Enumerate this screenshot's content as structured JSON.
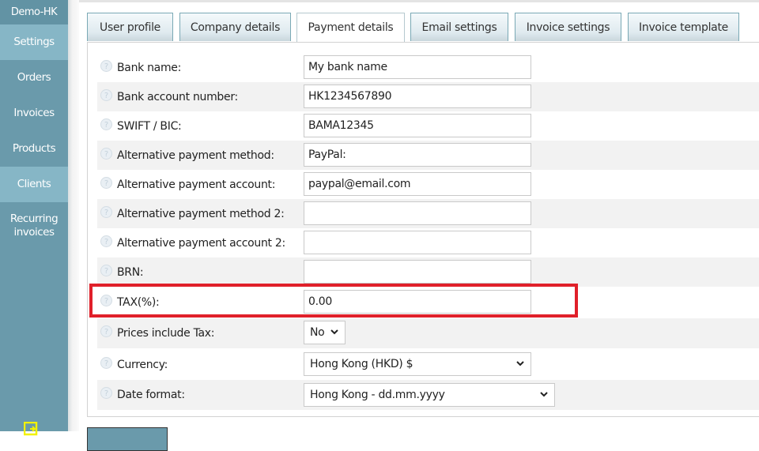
{
  "sidebar": {
    "brand": "Demo-HK",
    "items": [
      {
        "label": "Settings",
        "active": true
      },
      {
        "label": "Orders",
        "active": false
      },
      {
        "label": "Invoices",
        "active": false
      },
      {
        "label": "Products",
        "active": false
      },
      {
        "label": "Clients",
        "active": true
      },
      {
        "label": "Recurring invoices",
        "active": false
      }
    ],
    "exit_icon": "exit-icon",
    "accent_color": "#6a9aab"
  },
  "tabs": [
    {
      "label": "User profile",
      "active": false
    },
    {
      "label": "Company details",
      "active": false
    },
    {
      "label": "Payment details",
      "active": true
    },
    {
      "label": "Email settings",
      "active": false
    },
    {
      "label": "Invoice settings",
      "active": false
    },
    {
      "label": "Invoice template",
      "active": false
    }
  ],
  "form": {
    "help_icon": "question-circle-icon",
    "rows": [
      {
        "label": "Bank name:",
        "type": "text",
        "value": "My bank name"
      },
      {
        "label": "Bank account number:",
        "type": "text",
        "value": "HK1234567890"
      },
      {
        "label": "SWIFT / BIC:",
        "type": "text",
        "value": "BAMA12345"
      },
      {
        "label": "Alternative payment method:",
        "type": "text",
        "value": "PayPal:"
      },
      {
        "label": "Alternative payment account:",
        "type": "text",
        "value": "paypal@email.com"
      },
      {
        "label": "Alternative payment method 2:",
        "type": "text",
        "value": ""
      },
      {
        "label": "Alternative payment account 2:",
        "type": "text",
        "value": ""
      },
      {
        "label": "BRN:",
        "type": "text",
        "value": ""
      },
      {
        "label": "TAX(%):",
        "type": "text",
        "value": "0.00",
        "highlighted": true
      },
      {
        "label": "Prices include Tax:",
        "type": "select",
        "value": "No"
      },
      {
        "label": "Currency:",
        "type": "select",
        "value": "Hong Kong (HKD) $"
      },
      {
        "label": "Date format:",
        "type": "select",
        "value": "Hong Kong - dd.mm.yyyy"
      }
    ]
  },
  "highlight_color": "#e0202a"
}
